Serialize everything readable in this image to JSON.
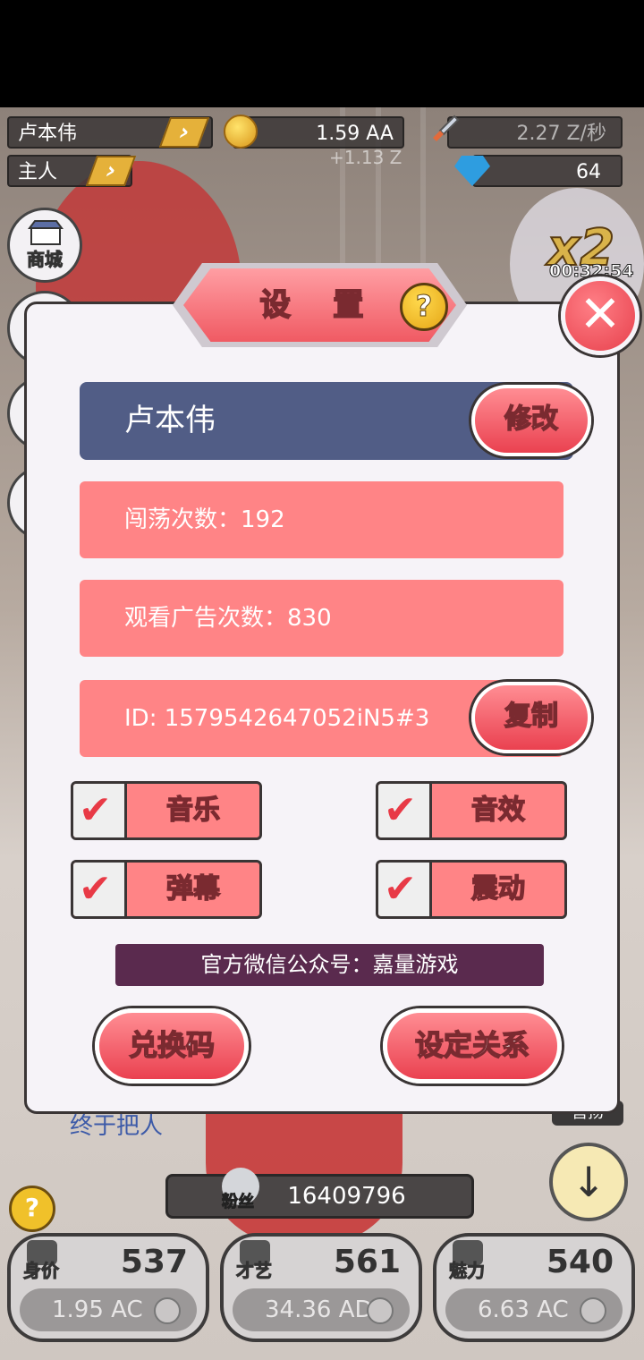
{
  "hud": {
    "player_name": "卢本伟",
    "gold": "1.59 AA",
    "gold_rate_small": "+1.13 Z",
    "speed_rate": "2.27 Z/秒",
    "role": "主人",
    "gems": "64",
    "boost": "x2",
    "boost_timer": "00:32:54"
  },
  "side": {
    "shop_label": "商城"
  },
  "settings": {
    "title": "设 置",
    "help_icon_text": "?",
    "close_icon_text": "✕",
    "name": "卢本伟",
    "edit_button": "修改",
    "visits": "闯荡次数：192",
    "ads_watched": "观看广告次数：830",
    "id_text": "ID: 1579542647052iN5#3",
    "copy_button": "复制",
    "toggles": {
      "music": {
        "label": "音乐",
        "checked": true
      },
      "sfx": {
        "label": "音效",
        "checked": true
      },
      "danmaku": {
        "label": "弹幕",
        "checked": true
      },
      "vibration": {
        "label": "震动",
        "checked": true
      }
    },
    "check_glyph": "✔",
    "wechat": "官方微信公众号：嘉量游戏",
    "redeem_button": "兑换码",
    "relation_button": "设定关系"
  },
  "bottom": {
    "background_text": "终于把人",
    "help_text": "?",
    "fans_label": "粉丝",
    "fans_value": "16409796",
    "tag_label": "营扬",
    "down_icon": "↓",
    "stats": [
      {
        "label": "身价",
        "level": "537",
        "cost": "1.95 AC"
      },
      {
        "label": "才艺",
        "level": "561",
        "cost": "34.36 AD"
      },
      {
        "label": "魅力",
        "level": "540",
        "cost": "6.63 AC"
      }
    ]
  }
}
